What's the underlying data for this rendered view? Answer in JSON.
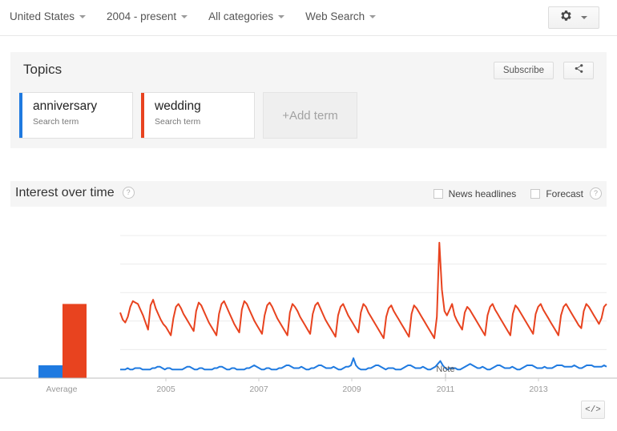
{
  "topbar": {
    "filters": [
      {
        "label": "United States",
        "name": "filter-region"
      },
      {
        "label": "2004 - present",
        "name": "filter-time"
      },
      {
        "label": "All categories",
        "name": "filter-category"
      },
      {
        "label": "Web Search",
        "name": "filter-search-type"
      }
    ],
    "settings_icon": "gear-icon"
  },
  "topics": {
    "title": "Topics",
    "subscribe_label": "Subscribe",
    "share_icon": "share-icon",
    "terms": [
      {
        "name": "anniversary",
        "subtitle": "Search term",
        "color": "#1f7ae0"
      },
      {
        "name": "wedding",
        "subtitle": "Search term",
        "color": "#e8431f"
      }
    ],
    "add_term_label": "+Add term"
  },
  "interest_over_time": {
    "title": "Interest over time",
    "help_icon": "help-icon",
    "options": [
      {
        "label": "News headlines",
        "checked": false
      },
      {
        "label": "Forecast",
        "checked": false,
        "help": true
      }
    ],
    "embed_label": "</>"
  },
  "chart_data": {
    "type": "line",
    "title": "Interest over time",
    "xlabel": "",
    "ylabel": "",
    "ylim": [
      0,
      100
    ],
    "grid": true,
    "legend_position": "none",
    "note_annotation": "Note",
    "average_axis_label": "Average",
    "x_tick_labels": [
      "2005",
      "2007",
      "2009",
      "2011",
      "2013"
    ],
    "averages": [
      {
        "name": "anniversary",
        "value": 9,
        "color": "#1f7ae0"
      },
      {
        "name": "wedding",
        "value": 52,
        "color": "#e8431f"
      }
    ],
    "series": [
      {
        "name": "anniversary",
        "color": "#1f7ae0",
        "values": [
          6,
          6,
          6,
          7,
          6,
          6,
          7,
          7,
          7,
          6,
          6,
          6,
          6,
          7,
          7,
          8,
          8,
          7,
          6,
          7,
          7,
          6,
          6,
          6,
          6,
          6,
          7,
          8,
          8,
          7,
          6,
          6,
          7,
          7,
          6,
          6,
          6,
          6,
          7,
          7,
          8,
          8,
          7,
          6,
          6,
          7,
          7,
          6,
          6,
          6,
          6,
          7,
          7,
          8,
          9,
          8,
          7,
          6,
          6,
          7,
          7,
          6,
          6,
          6,
          7,
          7,
          8,
          9,
          9,
          8,
          7,
          7,
          7,
          8,
          7,
          6,
          6,
          7,
          7,
          8,
          9,
          9,
          8,
          7,
          7,
          7,
          8,
          7,
          6,
          6,
          7,
          8,
          8,
          9,
          14,
          9,
          7,
          6,
          6,
          6,
          7,
          7,
          8,
          9,
          9,
          8,
          7,
          6,
          7,
          7,
          7,
          6,
          6,
          6,
          7,
          8,
          9,
          9,
          8,
          7,
          7,
          7,
          8,
          7,
          6,
          6,
          7,
          8,
          10,
          12,
          9,
          7,
          6,
          7,
          7,
          7,
          6,
          6,
          7,
          8,
          9,
          10,
          9,
          8,
          7,
          7,
          8,
          7,
          6,
          6,
          7,
          8,
          9,
          9,
          8,
          7,
          7,
          7,
          8,
          7,
          6,
          6,
          7,
          8,
          9,
          9,
          9,
          8,
          7,
          7,
          7,
          8,
          7,
          7,
          7,
          8,
          9,
          9,
          9,
          8,
          8,
          8,
          8,
          9,
          8,
          7,
          7,
          8,
          9,
          9,
          9,
          8,
          8,
          8,
          8,
          9,
          8
        ]
      },
      {
        "name": "wedding",
        "color": "#e8431f",
        "values": [
          46,
          41,
          39,
          43,
          50,
          54,
          53,
          52,
          48,
          44,
          39,
          34,
          51,
          55,
          49,
          45,
          41,
          38,
          36,
          33,
          30,
          42,
          50,
          52,
          49,
          45,
          42,
          39,
          36,
          33,
          47,
          53,
          51,
          47,
          43,
          39,
          36,
          33,
          30,
          45,
          52,
          54,
          50,
          46,
          42,
          38,
          35,
          32,
          48,
          54,
          52,
          48,
          44,
          40,
          37,
          34,
          31,
          44,
          51,
          53,
          50,
          46,
          42,
          39,
          36,
          33,
          30,
          46,
          52,
          50,
          47,
          43,
          40,
          37,
          34,
          31,
          45,
          51,
          53,
          49,
          45,
          41,
          38,
          35,
          32,
          29,
          44,
          50,
          52,
          48,
          44,
          41,
          38,
          35,
          32,
          46,
          52,
          50,
          46,
          43,
          40,
          37,
          34,
          31,
          28,
          43,
          49,
          51,
          47,
          44,
          41,
          38,
          35,
          32,
          29,
          45,
          51,
          49,
          46,
          43,
          40,
          37,
          34,
          31,
          28,
          43,
          95,
          62,
          47,
          44,
          48,
          52,
          44,
          40,
          37,
          34,
          46,
          50,
          48,
          45,
          42,
          39,
          36,
          33,
          30,
          44,
          50,
          52,
          48,
          45,
          42,
          39,
          36,
          33,
          30,
          45,
          51,
          49,
          46,
          43,
          40,
          37,
          34,
          31,
          45,
          50,
          52,
          48,
          45,
          42,
          39,
          36,
          33,
          30,
          44,
          50,
          52,
          49,
          46,
          43,
          40,
          37,
          35,
          47,
          52,
          50,
          47,
          44,
          41,
          38,
          42,
          50,
          52
        ]
      }
    ]
  }
}
